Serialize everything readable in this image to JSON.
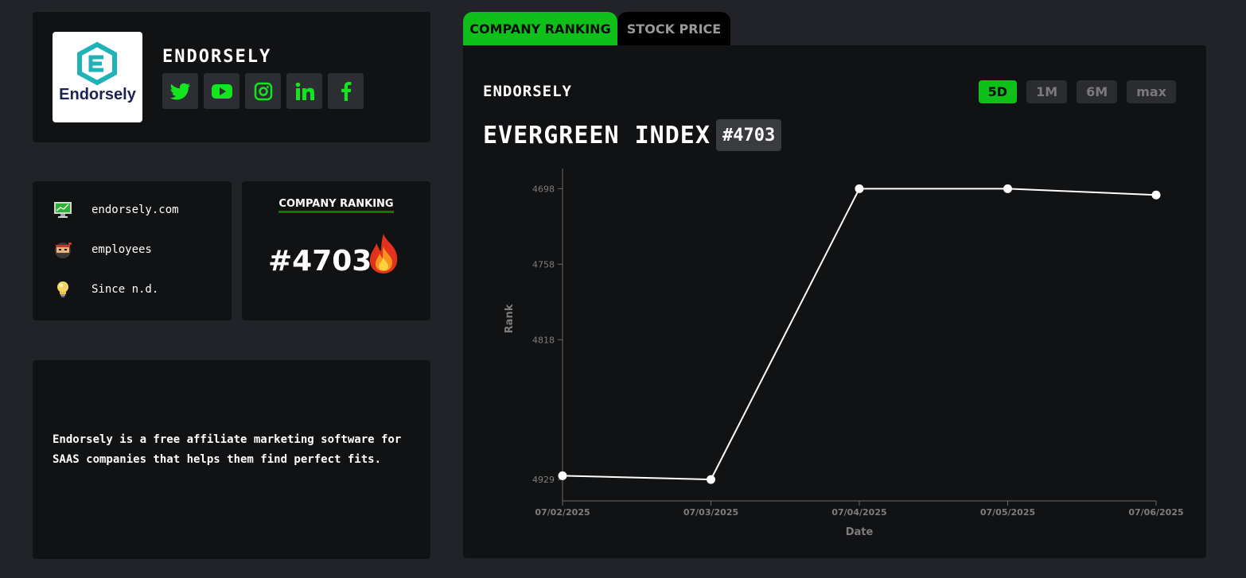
{
  "company": {
    "name": "ENDORSELY",
    "logo_text": "Endorsely"
  },
  "socials": [
    {
      "name": "twitter"
    },
    {
      "name": "youtube"
    },
    {
      "name": "instagram"
    },
    {
      "name": "linkedin"
    },
    {
      "name": "facebook"
    }
  ],
  "info": {
    "website": "endorsely.com",
    "employees": "employees",
    "since": "Since n.d."
  },
  "ranking": {
    "title": "COMPANY RANKING",
    "value": "#4703"
  },
  "description": "Endorsely is a free affiliate marketing software for SAAS companies that helps them find perfect fits.",
  "tabs": [
    {
      "label": "COMPANY RANKING",
      "active": true
    },
    {
      "label": "STOCK PRICE",
      "active": false
    }
  ],
  "panel": {
    "company": "ENDORSELY",
    "index_title": "EVERGREEN INDEX",
    "index_badge": "#4703",
    "ranges": [
      {
        "label": "5D",
        "active": true
      },
      {
        "label": "1M",
        "active": false
      },
      {
        "label": "6M",
        "active": false
      },
      {
        "label": "max",
        "active": false
      }
    ]
  },
  "colors": {
    "accent": "#0fbf1a",
    "background": "#212328",
    "card": "#111214"
  },
  "chart_data": {
    "type": "line",
    "x": [
      "07/02/2025",
      "07/03/2025",
      "07/04/2025",
      "07/05/2025",
      "07/06/2025"
    ],
    "values": [
      4926,
      4929,
      4698,
      4698,
      4703
    ],
    "xlabel": "Date",
    "ylabel": "Rank",
    "y_ticks": [
      4698,
      4758,
      4818,
      4929
    ],
    "ylim": [
      4682,
      4946
    ],
    "y_inverted": true
  }
}
